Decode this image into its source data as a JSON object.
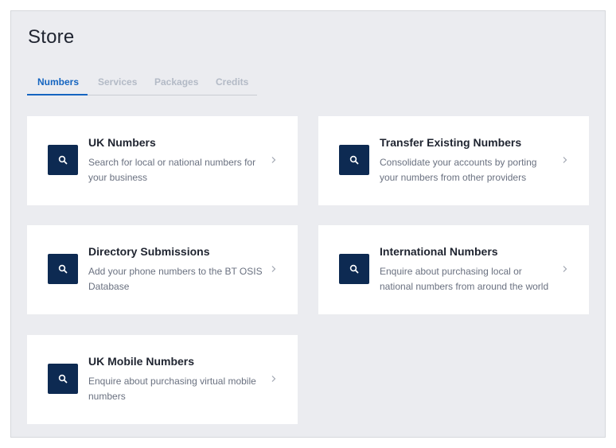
{
  "header": {
    "title": "Store"
  },
  "tabs": [
    {
      "label": "Numbers",
      "active": true
    },
    {
      "label": "Services",
      "active": false
    },
    {
      "label": "Packages",
      "active": false
    },
    {
      "label": "Credits",
      "active": false
    }
  ],
  "cards": [
    {
      "title": "UK Numbers",
      "description": "Search for local or national numbers for your business",
      "icon": "search-icon"
    },
    {
      "title": "Transfer Existing Numbers",
      "description": "Consolidate your accounts by porting your numbers from other providers",
      "icon": "search-icon"
    },
    {
      "title": "Directory Submissions",
      "description": "Add your phone numbers to the BT OSIS Database",
      "icon": "search-icon"
    },
    {
      "title": "International Numbers",
      "description": "Enquire about purchasing local or national numbers from around the world",
      "icon": "search-icon"
    },
    {
      "title": "UK Mobile Numbers",
      "description": "Enquire about purchasing virtual mobile numbers",
      "icon": "search-icon"
    }
  ],
  "colors": {
    "accent": "#1565c0",
    "icon_background": "#0d2a52",
    "page_background": "#ebecf0",
    "card_background": "#ffffff"
  }
}
